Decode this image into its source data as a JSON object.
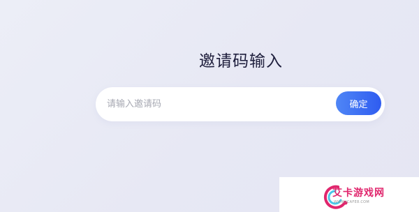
{
  "page": {
    "title": "邀请码输入"
  },
  "invite_form": {
    "placeholder": "请输入邀请码",
    "value": "",
    "confirm_label": "确定"
  },
  "watermark": {
    "brand_text": "艾卡游戏网",
    "sub_text": "WWW.ICAFE8.COM",
    "logo_icon": "swirl-logo-icon"
  },
  "colors": {
    "accent_start": "#4f86f6",
    "accent_end": "#2f5cf0",
    "brand": "#e0266d"
  }
}
